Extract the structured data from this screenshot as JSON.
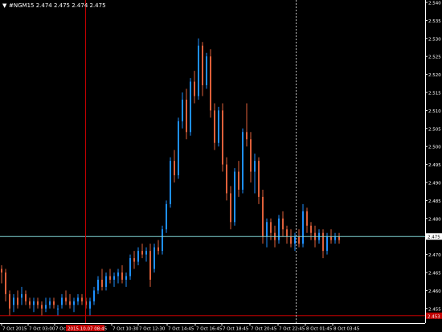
{
  "header": {
    "arrow": "▼",
    "title": "#NGM15 2.474 2.475 2.474 2.475"
  },
  "price_axis": {
    "ticks": [
      "2.540",
      "2.535",
      "2.530",
      "2.525",
      "2.520",
      "2.515",
      "2.510",
      "2.505",
      "2.500",
      "2.495",
      "2.490",
      "2.485",
      "2.480",
      "2.475",
      "2.470",
      "2.465",
      "2.460",
      "2.455"
    ],
    "current_price_label": "2.475",
    "crosshair_price_label": "2.453"
  },
  "time_axis": {
    "labels": [
      "7 Oct 2015",
      "7 Oct 03:00",
      "7 Oct 06:45",
      "7 Oct 10:30",
      "7 Oct 12:30",
      "7 Oct 14:45",
      "7 Oct 16:45",
      "7 Oct 18:45",
      "7 Oct 20:45",
      "7 Oct 22:45",
      "8 Oct 01:45",
      "8 Oct 03:45"
    ],
    "crosshair_time_label": "2015.10.07 08:45"
  },
  "colors": {
    "background": "#000000",
    "bull": "#1E90FF",
    "bear": "#E0603A",
    "crosshair": "#C00000",
    "bid_line": "#7FD4D4",
    "axis_text": "#FFFFFF",
    "price_tag_bg": "#FFFFFF",
    "crosshair_tag_bg": "#C00000"
  },
  "chart_data": {
    "type": "candlestick",
    "symbol": "#NGM15",
    "y_range": [
      2.45,
      2.541
    ],
    "series": [
      {
        "idx": 0,
        "o": 2.466,
        "h": 2.467,
        "l": 2.462,
        "c": 2.465
      },
      {
        "idx": 2,
        "o": 2.465,
        "h": 2.466,
        "l": 2.457,
        "c": 2.459
      },
      {
        "idx": 4,
        "o": 2.459,
        "h": 2.46,
        "l": 2.453,
        "c": 2.455
      },
      {
        "idx": 6,
        "o": 2.456,
        "h": 2.459,
        "l": 2.454,
        "c": 2.458
      },
      {
        "idx": 8,
        "o": 2.458,
        "h": 2.46,
        "l": 2.455,
        "c": 2.456
      },
      {
        "idx": 10,
        "o": 2.458,
        "h": 2.461,
        "l": 2.456,
        "c": 2.459
      },
      {
        "idx": 12,
        "o": 2.459,
        "h": 2.46,
        "l": 2.456,
        "c": 2.457
      },
      {
        "idx": 14,
        "o": 2.457,
        "h": 2.458,
        "l": 2.455,
        "c": 2.456
      },
      {
        "idx": 16,
        "o": 2.456,
        "h": 2.458,
        "l": 2.454,
        "c": 2.457
      },
      {
        "idx": 18,
        "o": 2.457,
        "h": 2.458,
        "l": 2.455,
        "c": 2.456
      },
      {
        "idx": 20,
        "o": 2.456,
        "h": 2.457,
        "l": 2.453,
        "c": 2.455
      },
      {
        "idx": 22,
        "o": 2.455,
        "h": 2.458,
        "l": 2.454,
        "c": 2.456
      },
      {
        "idx": 24,
        "o": 2.456,
        "h": 2.458,
        "l": 2.455,
        "c": 2.457
      },
      {
        "idx": 26,
        "o": 2.457,
        "h": 2.458,
        "l": 2.455,
        "c": 2.456
      },
      {
        "idx": 28,
        "o": 2.455,
        "h": 2.456,
        "l": 2.453,
        "c": 2.455
      },
      {
        "idx": 30,
        "o": 2.456,
        "h": 2.459,
        "l": 2.455,
        "c": 2.458
      },
      {
        "idx": 32,
        "o": 2.458,
        "h": 2.46,
        "l": 2.456,
        "c": 2.457
      },
      {
        "idx": 34,
        "o": 2.457,
        "h": 2.459,
        "l": 2.455,
        "c": 2.456
      },
      {
        "idx": 36,
        "o": 2.456,
        "h": 2.458,
        "l": 2.454,
        "c": 2.457
      },
      {
        "idx": 38,
        "o": 2.457,
        "h": 2.459,
        "l": 2.456,
        "c": 2.458
      },
      {
        "idx": 40,
        "o": 2.458,
        "h": 2.459,
        "l": 2.456,
        "c": 2.457
      },
      {
        "idx": 42,
        "o": 2.457,
        "h": 2.458,
        "l": 2.455,
        "c": 2.456
      },
      {
        "idx": 44,
        "o": 2.455,
        "h": 2.458,
        "l": 2.453,
        "c": 2.457
      },
      {
        "idx": 46,
        "o": 2.457,
        "h": 2.461,
        "l": 2.456,
        "c": 2.46
      },
      {
        "idx": 48,
        "o": 2.46,
        "h": 2.464,
        "l": 2.459,
        "c": 2.463
      },
      {
        "idx": 50,
        "o": 2.463,
        "h": 2.466,
        "l": 2.46,
        "c": 2.461
      },
      {
        "idx": 52,
        "o": 2.461,
        "h": 2.465,
        "l": 2.46,
        "c": 2.464
      },
      {
        "idx": 54,
        "o": 2.464,
        "h": 2.466,
        "l": 2.462,
        "c": 2.463
      },
      {
        "idx": 56,
        "o": 2.463,
        "h": 2.465,
        "l": 2.461,
        "c": 2.464
      },
      {
        "idx": 58,
        "o": 2.464,
        "h": 2.466,
        "l": 2.462,
        "c": 2.465
      },
      {
        "idx": 60,
        "o": 2.465,
        "h": 2.467,
        "l": 2.462,
        "c": 2.463
      },
      {
        "idx": 62,
        "o": 2.463,
        "h": 2.465,
        "l": 2.461,
        "c": 2.464
      },
      {
        "idx": 64,
        "o": 2.464,
        "h": 2.47,
        "l": 2.463,
        "c": 2.469
      },
      {
        "idx": 66,
        "o": 2.469,
        "h": 2.471,
        "l": 2.466,
        "c": 2.468
      },
      {
        "idx": 68,
        "o": 2.468,
        "h": 2.472,
        "l": 2.467,
        "c": 2.471
      },
      {
        "idx": 70,
        "o": 2.471,
        "h": 2.473,
        "l": 2.469,
        "c": 2.47
      },
      {
        "idx": 72,
        "o": 2.47,
        "h": 2.472,
        "l": 2.468,
        "c": 2.471
      },
      {
        "idx": 74,
        "o": 2.471,
        "h": 2.473,
        "l": 2.461,
        "c": 2.463
      },
      {
        "idx": 76,
        "o": 2.466,
        "h": 2.473,
        "l": 2.465,
        "c": 2.472
      },
      {
        "idx": 78,
        "o": 2.472,
        "h": 2.474,
        "l": 2.47,
        "c": 2.471
      },
      {
        "idx": 80,
        "o": 2.471,
        "h": 2.478,
        "l": 2.47,
        "c": 2.477
      },
      {
        "idx": 82,
        "o": 2.477,
        "h": 2.485,
        "l": 2.476,
        "c": 2.484
      },
      {
        "idx": 84,
        "o": 2.484,
        "h": 2.497,
        "l": 2.483,
        "c": 2.496
      },
      {
        "idx": 86,
        "o": 2.496,
        "h": 2.499,
        "l": 2.49,
        "c": 2.492
      },
      {
        "idx": 88,
        "o": 2.492,
        "h": 2.508,
        "l": 2.491,
        "c": 2.507
      },
      {
        "idx": 90,
        "o": 2.507,
        "h": 2.515,
        "l": 2.505,
        "c": 2.513
      },
      {
        "idx": 92,
        "o": 2.513,
        "h": 2.516,
        "l": 2.502,
        "c": 2.504
      },
      {
        "idx": 94,
        "o": 2.504,
        "h": 2.519,
        "l": 2.503,
        "c": 2.518
      },
      {
        "idx": 96,
        "o": 2.518,
        "h": 2.521,
        "l": 2.512,
        "c": 2.514
      },
      {
        "idx": 98,
        "o": 2.514,
        "h": 2.53,
        "l": 2.513,
        "c": 2.528
      },
      {
        "idx": 100,
        "o": 2.528,
        "h": 2.529,
        "l": 2.514,
        "c": 2.517
      },
      {
        "idx": 102,
        "o": 2.517,
        "h": 2.526,
        "l": 2.516,
        "c": 2.525
      },
      {
        "idx": 104,
        "o": 2.525,
        "h": 2.527,
        "l": 2.508,
        "c": 2.51
      },
      {
        "idx": 106,
        "o": 2.51,
        "h": 2.512,
        "l": 2.499,
        "c": 2.501
      },
      {
        "idx": 108,
        "o": 2.501,
        "h": 2.511,
        "l": 2.5,
        "c": 2.51
      },
      {
        "idx": 110,
        "o": 2.51,
        "h": 2.512,
        "l": 2.493,
        "c": 2.495
      },
      {
        "idx": 112,
        "o": 2.495,
        "h": 2.497,
        "l": 2.485,
        "c": 2.487
      },
      {
        "idx": 114,
        "o": 2.487,
        "h": 2.489,
        "l": 2.477,
        "c": 2.479
      },
      {
        "idx": 116,
        "o": 2.479,
        "h": 2.494,
        "l": 2.478,
        "c": 2.493
      },
      {
        "idx": 118,
        "o": 2.493,
        "h": 2.496,
        "l": 2.486,
        "c": 2.488
      },
      {
        "idx": 120,
        "o": 2.488,
        "h": 2.505,
        "l": 2.487,
        "c": 2.504
      },
      {
        "idx": 122,
        "o": 2.504,
        "h": 2.512,
        "l": 2.5,
        "c": 2.502
      },
      {
        "idx": 124,
        "o": 2.502,
        "h": 2.504,
        "l": 2.49,
        "c": 2.493
      },
      {
        "idx": 126,
        "o": 2.493,
        "h": 2.498,
        "l": 2.487,
        "c": 2.496
      },
      {
        "idx": 128,
        "o": 2.496,
        "h": 2.497,
        "l": 2.484,
        "c": 2.486
      },
      {
        "idx": 130,
        "o": 2.486,
        "h": 2.488,
        "l": 2.473,
        "c": 2.475
      },
      {
        "idx": 132,
        "o": 2.475,
        "h": 2.48,
        "l": 2.472,
        "c": 2.479
      },
      {
        "idx": 134,
        "o": 2.479,
        "h": 2.48,
        "l": 2.474,
        "c": 2.476
      },
      {
        "idx": 136,
        "o": 2.476,
        "h": 2.478,
        "l": 2.472,
        "c": 2.474
      },
      {
        "idx": 138,
        "o": 2.474,
        "h": 2.481,
        "l": 2.473,
        "c": 2.48
      },
      {
        "idx": 140,
        "o": 2.48,
        "h": 2.482,
        "l": 2.475,
        "c": 2.477
      },
      {
        "idx": 142,
        "o": 2.477,
        "h": 2.478,
        "l": 2.473,
        "c": 2.475
      },
      {
        "idx": 144,
        "o": 2.475,
        "h": 2.477,
        "l": 2.472,
        "c": 2.473
      },
      {
        "idx": 146,
        "o": 2.473,
        "h": 2.476,
        "l": 2.471,
        "c": 2.475
      },
      {
        "idx": 148,
        "o": 2.475,
        "h": 2.477,
        "l": 2.472,
        "c": 2.473
      },
      {
        "idx": 150,
        "o": 2.473,
        "h": 2.484,
        "l": 2.472,
        "c": 2.482
      },
      {
        "idx": 152,
        "o": 2.482,
        "h": 2.483,
        "l": 2.476,
        "c": 2.478
      },
      {
        "idx": 154,
        "o": 2.478,
        "h": 2.479,
        "l": 2.474,
        "c": 2.476
      },
      {
        "idx": 156,
        "o": 2.476,
        "h": 2.478,
        "l": 2.472,
        "c": 2.474
      },
      {
        "idx": 158,
        "o": 2.474,
        "h": 2.477,
        "l": 2.473,
        "c": 2.476
      },
      {
        "idx": 160,
        "o": 2.476,
        "h": 2.477,
        "l": 2.469,
        "c": 2.471
      },
      {
        "idx": 162,
        "o": 2.471,
        "h": 2.476,
        "l": 2.47,
        "c": 2.475
      },
      {
        "idx": 164,
        "o": 2.475,
        "h": 2.477,
        "l": 2.473,
        "c": 2.474
      },
      {
        "idx": 166,
        "o": 2.474,
        "h": 2.476,
        "l": 2.473,
        "c": 2.475
      },
      {
        "idx": 168,
        "o": 2.475,
        "h": 2.476,
        "l": 2.473,
        "c": 2.474
      }
    ]
  }
}
